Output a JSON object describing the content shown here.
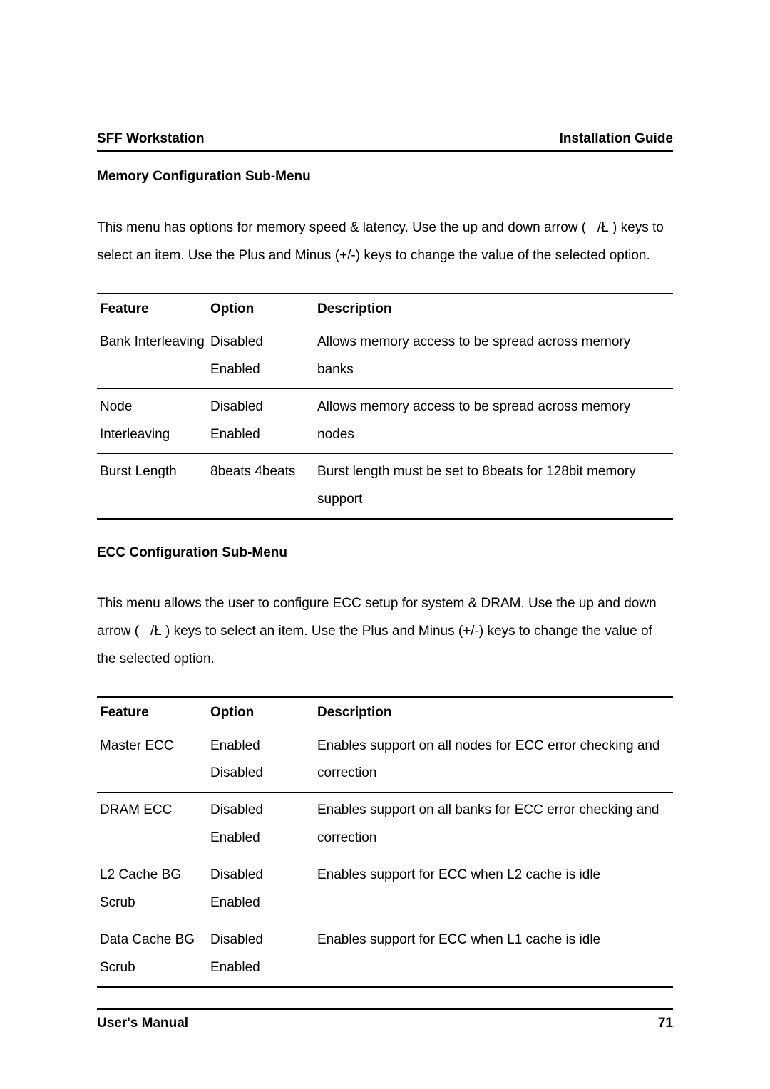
{
  "header": {
    "left": "SFF Workstation",
    "right": "Installation Guide"
  },
  "section1": {
    "title": "Memory Configuration Sub-Menu",
    "para": "This menu has options for memory speed & latency. Use the up and down arrow (   /Ł ) keys to select an item. Use the Plus and Minus (+/-) keys to change the value of the selected option."
  },
  "table1": {
    "headers": {
      "feature": "Feature",
      "option": "Option",
      "description": "Description"
    },
    "rows": [
      {
        "feature": "Bank Interleaving",
        "option": "Disabled Enabled",
        "description": "Allows memory access to be spread across memory banks"
      },
      {
        "feature": "Node Interleaving",
        "option": "Disabled Enabled",
        "description": "Allows memory access to be spread across memory nodes"
      },
      {
        "feature": "Burst Length",
        "option": "8beats 4beats",
        "description": "Burst length must be set to 8beats for 128bit memory support"
      }
    ]
  },
  "section2": {
    "title": "ECC Configuration Sub-Menu",
    "para": "This menu allows the user to configure ECC setup for system & DRAM. Use the up and down arrow (   /Ł ) keys to select an item. Use the Plus and Minus (+/-) keys to change the value of the selected option."
  },
  "table2": {
    "headers": {
      "feature": "Feature",
      "option": "Option",
      "description": "Description"
    },
    "rows": [
      {
        "feature": "Master ECC",
        "option": "Enabled Disabled",
        "description": "Enables support on all nodes for ECC error checking and correction"
      },
      {
        "feature": "DRAM ECC",
        "option": "Disabled Enabled",
        "description": "Enables support on all banks for ECC error checking and correction"
      },
      {
        "feature": "L2 Cache BG Scrub",
        "option": "Disabled Enabled",
        "description": "Enables support for ECC when L2 cache is idle"
      },
      {
        "feature": "Data Cache BG Scrub",
        "option": "Disabled Enabled",
        "description": "Enables support for ECC when L1 cache is idle"
      }
    ]
  },
  "footer": {
    "left": "User's Manual",
    "right": "71"
  }
}
